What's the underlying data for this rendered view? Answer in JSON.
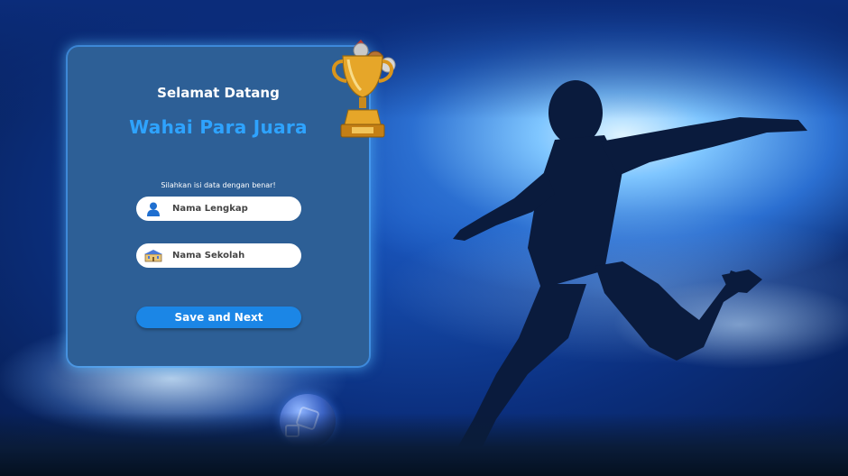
{
  "card": {
    "welcome": "Selamat Datang",
    "headline": "Wahai Para Juara",
    "instruction": "Silahkan isi data dengan benar!"
  },
  "form": {
    "name_field": {
      "placeholder": "Nama Lengkap",
      "value": "",
      "icon": "user-icon"
    },
    "school_field": {
      "placeholder": "Nama Sekolah",
      "value": "",
      "icon": "school-building-icon"
    },
    "submit_label": "Save and Next"
  },
  "colors": {
    "card_bg": "#2d5f96",
    "headline": "#2ea3ff",
    "button": "#1b86e6",
    "card_glow": "#5abeff"
  },
  "decor": {
    "trophy": "trophy-icon",
    "ball": "soccer-ball",
    "player": "player-silhouette"
  }
}
